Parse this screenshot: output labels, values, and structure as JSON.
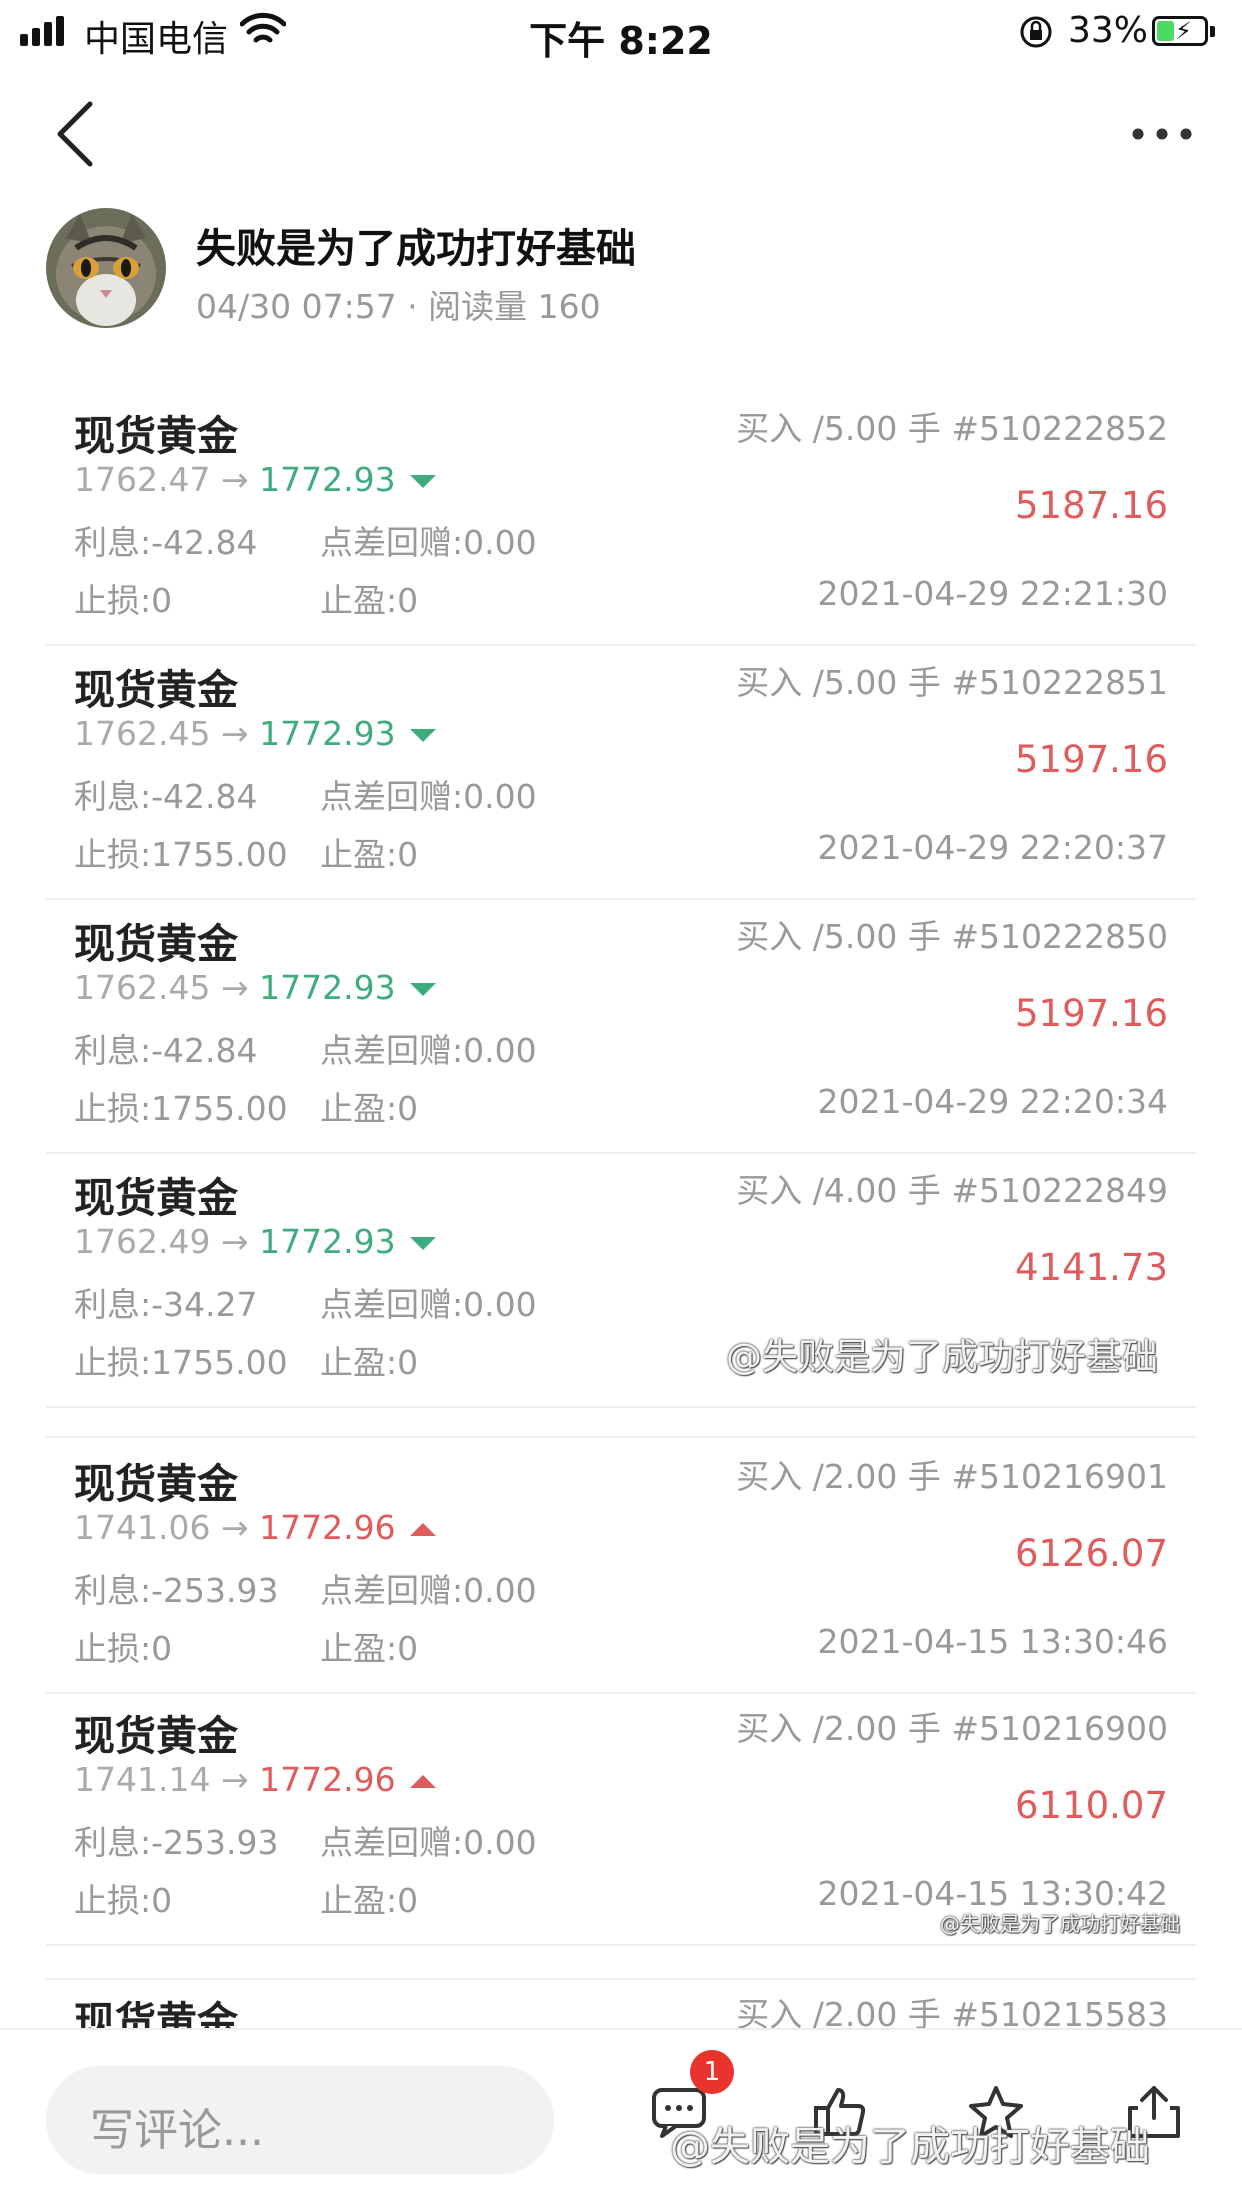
{
  "status_bar": {
    "carrier": "中国电信",
    "time": "下午 8:22",
    "battery": "33%"
  },
  "author": {
    "name": "失败是为了成功打好基础",
    "meta": "04/30 07:57 · 阅读量 160"
  },
  "trades": [
    {
      "name": "现货黄金",
      "side": "买入 /5.00 手",
      "order": "#510222852",
      "open": "1762.47",
      "arrow": "→",
      "current": "1772.93",
      "direction": "down",
      "profit": "5187.16",
      "interest": "利息:-42.84",
      "spread": "点差回赠:0.00",
      "stop_loss": "止损:0",
      "take_profit": "止盈:0",
      "time": "2021-04-29 22:21:30"
    },
    {
      "name": "现货黄金",
      "side": "买入 /5.00 手",
      "order": "#510222851",
      "open": "1762.45",
      "arrow": "→",
      "current": "1772.93",
      "direction": "down",
      "profit": "5197.16",
      "interest": "利息:-42.84",
      "spread": "点差回赠:0.00",
      "stop_loss": "止损:1755.00",
      "take_profit": "止盈:0",
      "time": "2021-04-29 22:20:37"
    },
    {
      "name": "现货黄金",
      "side": "买入 /5.00 手",
      "order": "#510222850",
      "open": "1762.45",
      "arrow": "→",
      "current": "1772.93",
      "direction": "down",
      "profit": "5197.16",
      "interest": "利息:-42.84",
      "spread": "点差回赠:0.00",
      "stop_loss": "止损:1755.00",
      "take_profit": "止盈:0",
      "time": "2021-04-29 22:20:34"
    },
    {
      "name": "现货黄金",
      "side": "买入 /4.00 手",
      "order": "#510222849",
      "open": "1762.49",
      "arrow": "→",
      "current": "1772.93",
      "direction": "down",
      "profit": "4141.73",
      "interest": "利息:-34.27",
      "spread": "点差回赠:0.00",
      "stop_loss": "止损:1755.00",
      "take_profit": "止盈:0",
      "time": ""
    },
    {
      "name": "现货黄金",
      "side": "买入 /2.00 手",
      "order": "#510216901",
      "open": "1741.06",
      "arrow": "→",
      "current": "1772.96",
      "direction": "up",
      "profit": "6126.07",
      "interest": "利息:-253.93",
      "spread": "点差回赠:0.00",
      "stop_loss": "止损:0",
      "take_profit": "止盈:0",
      "time": "2021-04-15 13:30:46"
    },
    {
      "name": "现货黄金",
      "side": "买入 /2.00 手",
      "order": "#510216900",
      "open": "1741.14",
      "arrow": "→",
      "current": "1772.96",
      "direction": "up",
      "profit": "6110.07",
      "interest": "利息:-253.93",
      "spread": "点差回赠:0.00",
      "stop_loss": "止损:0",
      "take_profit": "止盈:0",
      "time": "2021-04-15 13:30:42"
    }
  ],
  "partial_trade": {
    "name": "现货黄金",
    "side": "买入 /2.00 手",
    "order": "#510215583"
  },
  "watermarks": {
    "wm1": "@失败是为了成功打好基础",
    "wm2": "@失败是为了成功打好基础",
    "wm3": "@失败是为了成功打好基础"
  },
  "bottom_bar": {
    "comment_placeholder": "写评论...",
    "comment_badge": "1",
    "icons": [
      "comment-icon",
      "like-icon",
      "star-icon",
      "share-icon"
    ]
  },
  "colors": {
    "down": "#3eac7c",
    "up": "#e05b5b",
    "profit": "#e05b5b",
    "badge": "#e8342c"
  }
}
